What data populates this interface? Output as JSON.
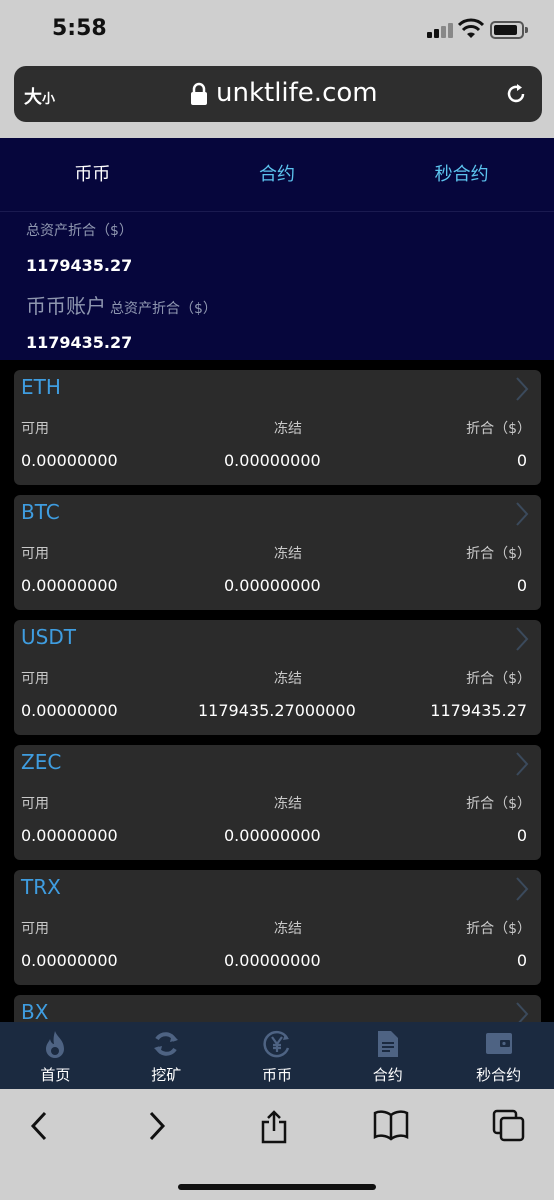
{
  "status": {
    "time": "5:58"
  },
  "browser": {
    "text_size_label": "大",
    "text_size_small": "小",
    "url": "unktlife.com"
  },
  "tabs": [
    {
      "label": "币币",
      "active": true
    },
    {
      "label": "合约",
      "active": false
    },
    {
      "label": "秒合约",
      "active": false
    }
  ],
  "summary": {
    "total_label": "总资产折合（$）",
    "total_value": "1179435.27",
    "account_title": "币币账户",
    "account_sub": "总资产折合（$）",
    "account_value": "1179435.27"
  },
  "columns": {
    "available": "可用",
    "frozen": "冻结",
    "converted": "折合（$）"
  },
  "assets": [
    {
      "coin": "ETH",
      "available": "0.00000000",
      "frozen": "0.00000000",
      "converted": "0"
    },
    {
      "coin": "BTC",
      "available": "0.00000000",
      "frozen": "0.00000000",
      "converted": "0"
    },
    {
      "coin": "USDT",
      "available": "0.00000000",
      "frozen": "1179435.27000000",
      "converted": "1179435.27"
    },
    {
      "coin": "ZEC",
      "available": "0.00000000",
      "frozen": "0.00000000",
      "converted": "0"
    },
    {
      "coin": "TRX",
      "available": "0.00000000",
      "frozen": "0.00000000",
      "converted": "0"
    },
    {
      "coin": "BX",
      "available": "",
      "frozen": "",
      "converted": ""
    }
  ],
  "bottom_nav": [
    {
      "label": "首页",
      "icon": "flame-icon"
    },
    {
      "label": "挖矿",
      "icon": "refresh-icon"
    },
    {
      "label": "币币",
      "icon": "yen-coin-icon"
    },
    {
      "label": "合约",
      "icon": "document-icon"
    },
    {
      "label": "秒合约",
      "icon": "wallet-icon"
    }
  ],
  "colors": {
    "header_bg": "#06063c",
    "tab_active": "#ffffff",
    "tab_inactive": "#5cc3ee",
    "coin": "#3f9de0",
    "card_bg": "#2b2b2b",
    "nav_bg": "#1b2a40"
  }
}
